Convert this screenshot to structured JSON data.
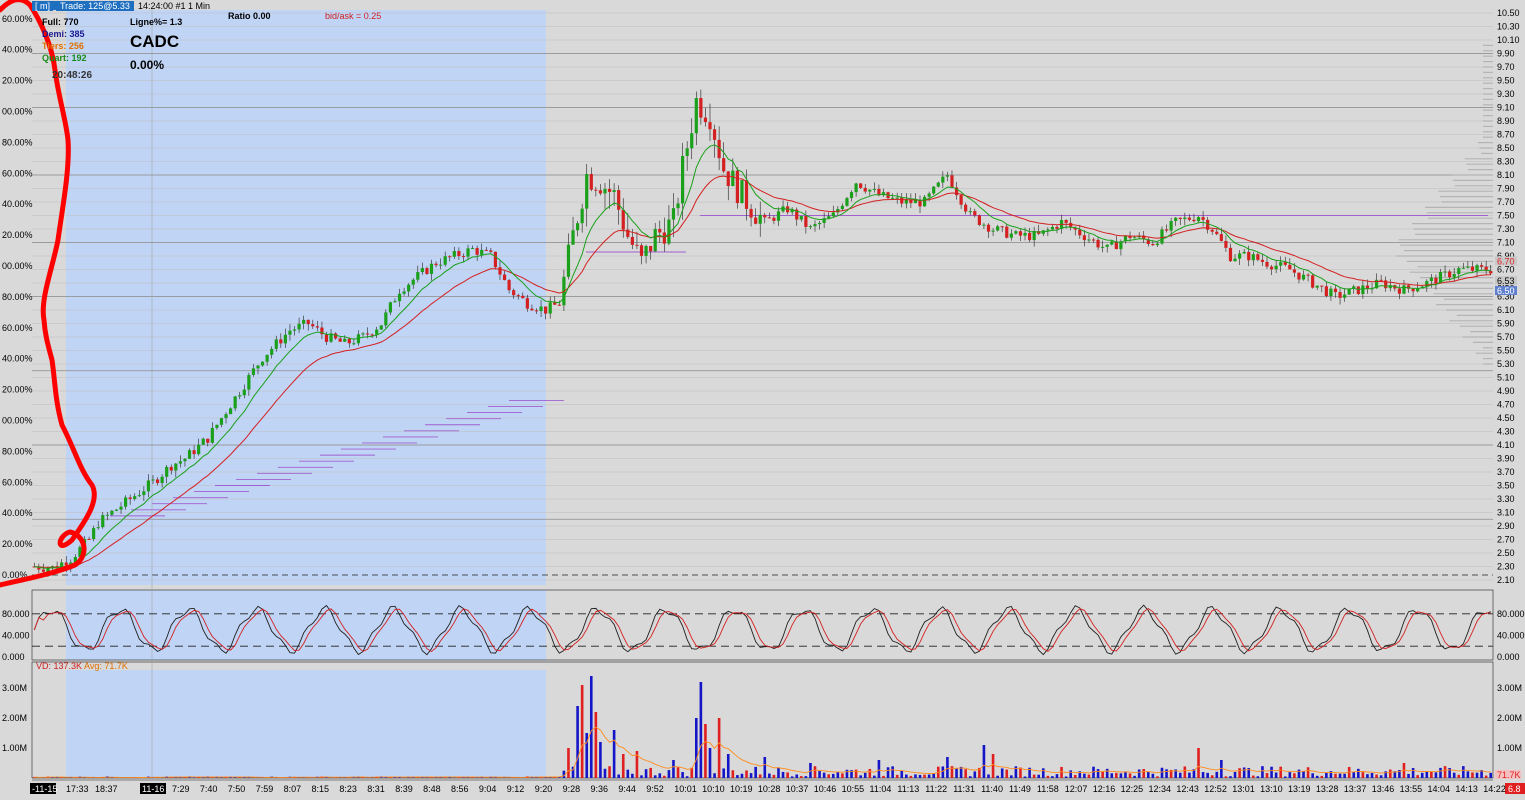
{
  "header": {
    "left_box": "[ m]",
    "trade": "Trade: 125@5.33",
    "time_frame": "14:24:00  #1 1 Min",
    "ratio": "Ratio 0.00",
    "bid_ask": "bid/ask = 0.25",
    "full": "Full: 770",
    "demi": "Demi: 385",
    "tiers": "Tiers: 256",
    "quart": "Quart: 192",
    "clock": "20:48:26",
    "ligne": "Ligne%= 1.3",
    "symbol": "CADC",
    "change": "0.00%",
    "vd_label": "VD: 137.3K",
    "avg_label": "Avg: 71.7K",
    "vol_badge": "71.7K",
    "stoch_badge": "6.8"
  },
  "colors": {
    "background": "#d9d9d9",
    "premarket": "#c0d4f5",
    "up": "#1aa01a",
    "down": "#d42020",
    "ema_fast": "#1aa01a",
    "ema_slow": "#d42020",
    "vol_up": "#1515c8",
    "vol_down": "#e02020",
    "vol_avg": "#ff8c1a",
    "annotation": "#ff0000",
    "grid": "#a8a8a8",
    "purple": "#a060d0"
  },
  "chart_data": [
    {
      "type": "candlestick",
      "left_axis_ticks": [
        "0.00%",
        "20.00%",
        "40.00%",
        "60.00%",
        "80.00%",
        "00.00%",
        "20.00%",
        "40.00%",
        "60.00%",
        "80.00%",
        "00.00%",
        "20.00%",
        "40.00%",
        "60.00%",
        "80.00%",
        "00.00%",
        "20.00%",
        "40.00%",
        "60.00%",
        "80.00%",
        ".00%"
      ],
      "right_axis_ticks": [
        "2.10",
        "2.30",
        "2.50",
        "2.70",
        "2.90",
        "3.10",
        "3.30",
        "3.50",
        "3.70",
        "3.90",
        "4.10",
        "4.30",
        "4.50",
        "4.70",
        "4.90",
        "5.10",
        "5.30",
        "5.50",
        "5.70",
        "5.90",
        "6.10",
        "6.30",
        "6.50",
        "6.70",
        "6.90",
        "7.10",
        "7.30",
        "7.50",
        "7.70",
        "7.90",
        "8.10",
        "8.30",
        "8.50",
        "8.70",
        "8.90",
        "9.10",
        "9.30",
        "9.50",
        "9.70",
        "9.90",
        "10.10",
        "10.30",
        "10.50"
      ],
      "ylim": [
        2.1,
        10.5
      ],
      "price_badges": [
        "6.70",
        "6.53",
        "6.50"
      ],
      "price_path": [
        [
          0,
          2.3
        ],
        [
          4,
          2.28
        ],
        [
          8,
          2.42
        ],
        [
          12,
          2.7
        ],
        [
          14,
          2.95
        ],
        [
          18,
          3.15
        ],
        [
          22,
          3.35
        ],
        [
          26,
          3.55
        ],
        [
          30,
          3.8
        ],
        [
          33,
          3.9
        ],
        [
          38,
          4.2
        ],
        [
          42,
          4.6
        ],
        [
          46,
          5.0
        ],
        [
          50,
          5.4
        ],
        [
          53,
          5.6
        ],
        [
          56,
          5.8
        ],
        [
          60,
          5.9
        ],
        [
          64,
          5.7
        ],
        [
          68,
          5.6
        ],
        [
          72,
          5.7
        ],
        [
          76,
          5.9
        ],
        [
          80,
          6.4
        ],
        [
          84,
          6.6
        ],
        [
          88,
          6.8
        ],
        [
          92,
          6.9
        ],
        [
          96,
          7.0
        ],
        [
          100,
          6.9
        ],
        [
          104,
          6.4
        ],
        [
          108,
          6.2
        ],
        [
          112,
          6.1
        ],
        [
          115,
          6.2
        ],
        [
          118,
          7.2
        ],
        [
          121,
          8.1
        ],
        [
          124,
          8.0
        ],
        [
          127,
          7.8
        ],
        [
          130,
          7.2
        ],
        [
          133,
          6.8
        ],
        [
          136,
          7.2
        ],
        [
          140,
          7.4
        ],
        [
          142,
          8.2
        ],
        [
          145,
          9.2
        ],
        [
          148,
          9.0
        ],
        [
          151,
          8.2
        ],
        [
          155,
          7.8
        ],
        [
          160,
          7.4
        ],
        [
          165,
          7.6
        ],
        [
          170,
          7.3
        ],
        [
          175,
          7.5
        ],
        [
          180,
          8.0
        ],
        [
          185,
          7.8
        ],
        [
          190,
          7.7
        ],
        [
          195,
          7.7
        ],
        [
          200,
          8.1
        ],
        [
          205,
          7.5
        ],
        [
          210,
          7.3
        ],
        [
          215,
          7.2
        ],
        [
          220,
          7.2
        ],
        [
          225,
          7.4
        ],
        [
          230,
          7.2
        ],
        [
          235,
          7.0
        ],
        [
          240,
          7.2
        ],
        [
          245,
          7.1
        ],
        [
          250,
          7.4
        ],
        [
          255,
          7.5
        ],
        [
          258,
          7.3
        ],
        [
          262,
          6.9
        ],
        [
          266,
          6.9
        ],
        [
          270,
          6.8
        ],
        [
          275,
          6.7
        ],
        [
          280,
          6.5
        ],
        [
          285,
          6.3
        ],
        [
          290,
          6.4
        ],
        [
          295,
          6.5
        ],
        [
          300,
          6.4
        ],
        [
          305,
          6.5
        ],
        [
          312,
          6.7
        ]
      ],
      "x_ticks": [
        "-11-15",
        "17:33",
        "18:37",
        "11-16",
        "7:29",
        "7:40",
        "7:50",
        "7:59",
        "8:07",
        "8:15",
        "8:23",
        "8:31",
        "8:39",
        "8:48",
        "8:56",
        "9:04",
        "9:12",
        "9:20",
        "9:28",
        "9:36",
        "9:44",
        "9:52",
        "10:01",
        "10:10",
        "10:19",
        "10:28",
        "10:37",
        "10:46",
        "10:55",
        "11:04",
        "11:13",
        "11:22",
        "11:31",
        "11:40",
        "11:49",
        "11:58",
        "12:07",
        "12:16",
        "12:25",
        "12:34",
        "12:43",
        "12:52",
        "13:01",
        "13:10",
        "13:19",
        "13:28",
        "13:37",
        "13:46",
        "13:55",
        "14:04",
        "14:13",
        "14:22"
      ]
    },
    {
      "type": "line",
      "name": "stochastic",
      "ticks": [
        "80.000",
        "40.000",
        "0.000"
      ],
      "levels": [
        80,
        20
      ],
      "ylim": [
        0,
        100
      ]
    },
    {
      "type": "bar",
      "name": "volume",
      "ticks": [
        "3.00M",
        "2.00M",
        "1.00M"
      ],
      "ylim": [
        0,
        3.6
      ],
      "spikes": [
        [
          117,
          1.0
        ],
        [
          119,
          2.4
        ],
        [
          120,
          3.1
        ],
        [
          121,
          1.5
        ],
        [
          122,
          3.4
        ],
        [
          123,
          2.2
        ],
        [
          124,
          1.2
        ],
        [
          127,
          1.6
        ],
        [
          129,
          0.8
        ],
        [
          132,
          0.9
        ],
        [
          140,
          0.6
        ],
        [
          145,
          2.0
        ],
        [
          146,
          3.2
        ],
        [
          147,
          1.8
        ],
        [
          148,
          1.0
        ],
        [
          150,
          2.0
        ],
        [
          152,
          0.8
        ],
        [
          160,
          0.7
        ],
        [
          170,
          0.5
        ],
        [
          185,
          0.6
        ],
        [
          200,
          0.7
        ],
        [
          208,
          1.1
        ],
        [
          210,
          0.8
        ],
        [
          255,
          1.0
        ],
        [
          260,
          0.6
        ],
        [
          300,
          0.5
        ]
      ]
    }
  ]
}
